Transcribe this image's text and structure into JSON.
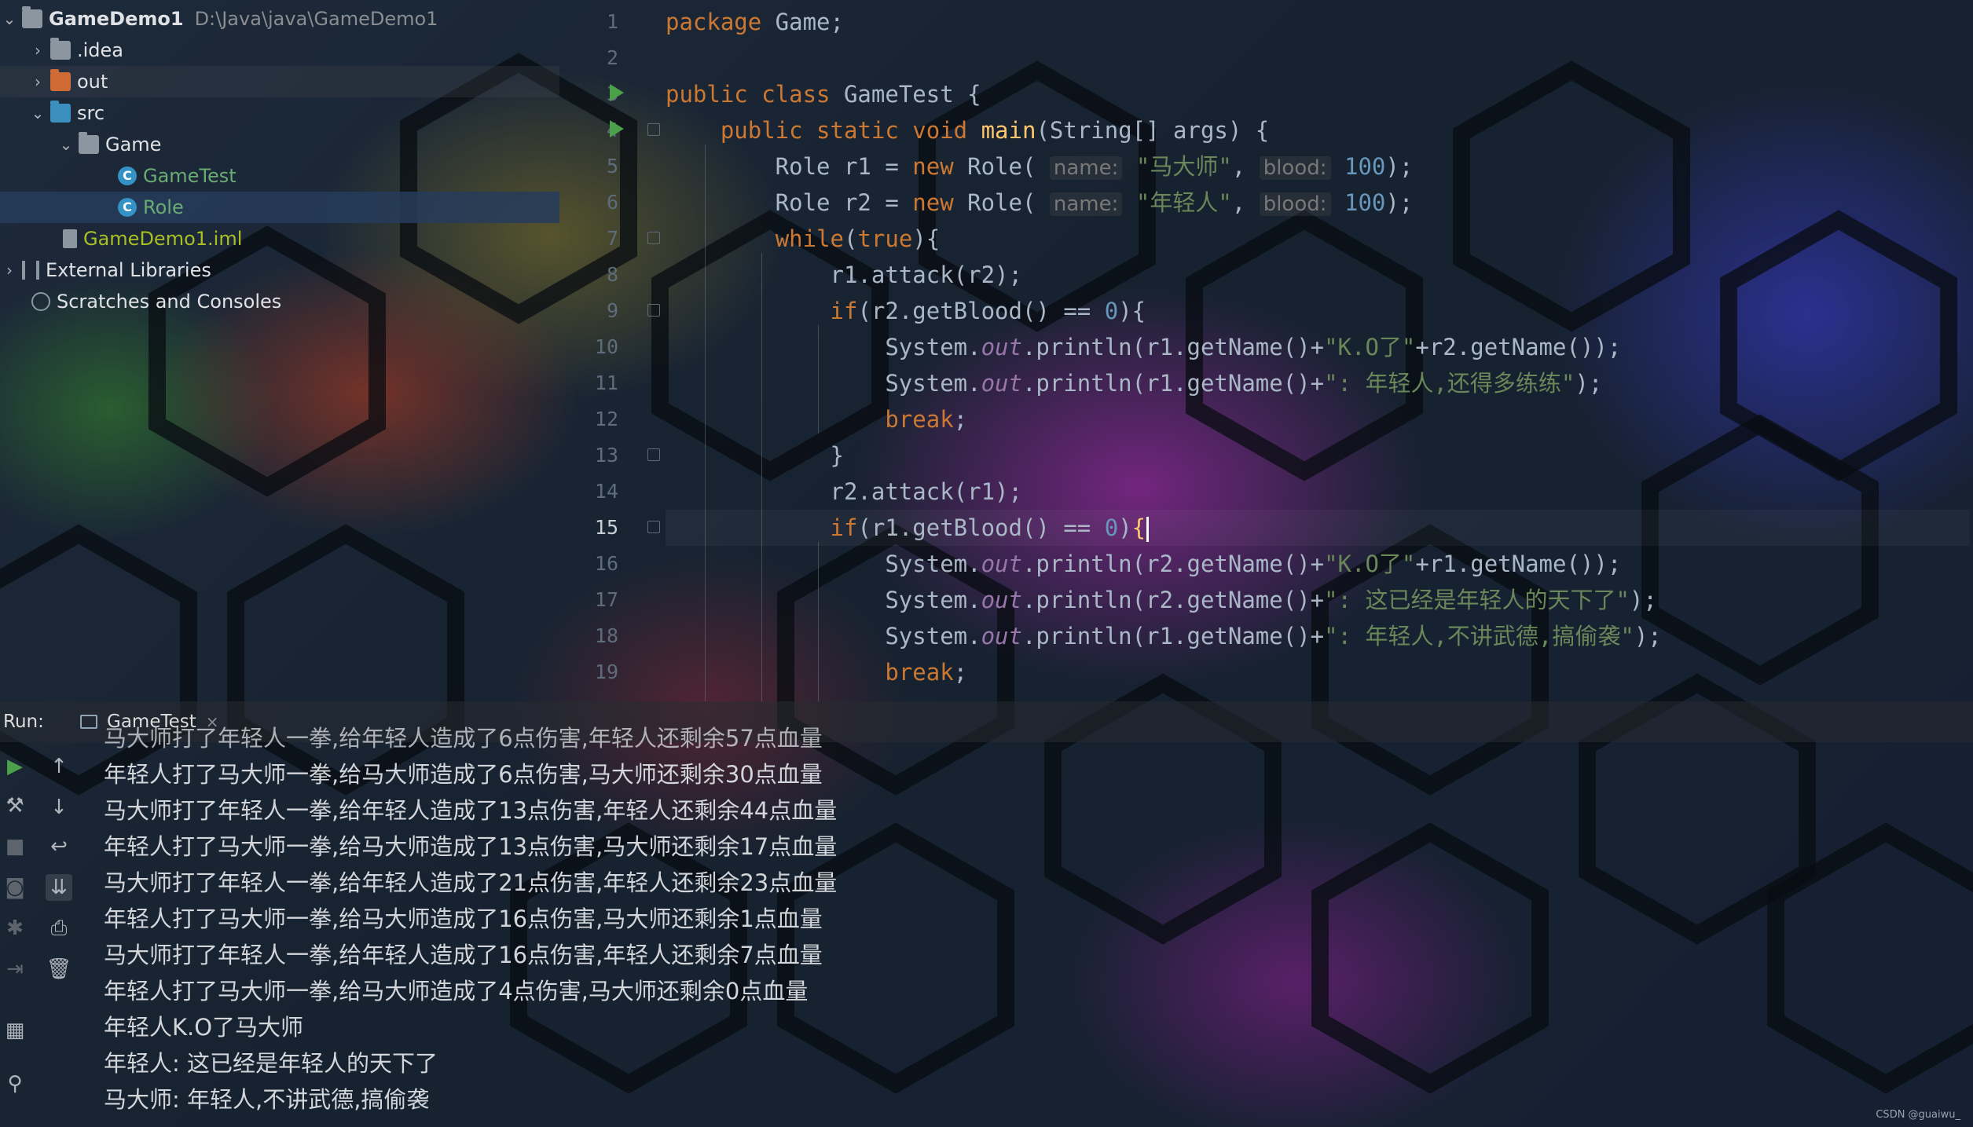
{
  "project": {
    "root_name": "GameDemo1",
    "root_path": "D:\\Java\\java\\GameDemo1",
    "items": [
      {
        "label": "GameDemo1",
        "icon": "folder-icon"
      },
      {
        "label": ".idea",
        "icon": "folder-icon"
      },
      {
        "label": "out",
        "icon": "folder-icon"
      },
      {
        "label": "src",
        "icon": "folder-icon"
      },
      {
        "label": "Game",
        "icon": "package-icon"
      },
      {
        "label": "GameTest",
        "icon": "java-class-icon"
      },
      {
        "label": "Role",
        "icon": "java-class-icon",
        "selected": true
      },
      {
        "label": "GameDemo1.iml",
        "icon": "module-file-icon"
      },
      {
        "label": "External Libraries",
        "icon": "library-icon"
      },
      {
        "label": "Scratches and Consoles",
        "icon": "scratches-icon"
      }
    ]
  },
  "editor": {
    "current_line": 15,
    "line_numbers": [
      "1",
      "2",
      "3",
      "4",
      "5",
      "6",
      "7",
      "8",
      "9",
      "10",
      "11",
      "12",
      "13",
      "14",
      "15",
      "16",
      "17",
      "18",
      "19"
    ]
  },
  "run": {
    "label": "Run:",
    "tab": "GameTest",
    "output": [
      "马大师打了年轻人一拳,给年轻人造成了6点伤害,年轻人还剩余57点血量",
      "年轻人打了马大师一拳,给马大师造成了6点伤害,马大师还剩余30点血量",
      "马大师打了年轻人一拳,给年轻人造成了13点伤害,年轻人还剩余44点血量",
      "年轻人打了马大师一拳,给马大师造成了13点伤害,马大师还剩余17点血量",
      "马大师打了年轻人一拳,给年轻人造成了21点伤害,年轻人还剩余23点血量",
      "年轻人打了马大师一拳,给马大师造成了16点伤害,马大师还剩余1点血量",
      "马大师打了年轻人一拳,给年轻人造成了16点伤害,年轻人还剩余7点血量",
      "年轻人打了马大师一拳,给马大师造成了4点伤害,马大师还剩余0点血量",
      "年轻人K.O了马大师",
      "年轻人: 这已经是年轻人的天下了",
      "马大师: 年轻人,不讲武德,搞偷袭"
    ]
  },
  "watermark": "CSDN @guaiwu_",
  "colors": {
    "keyword": "#cc7832",
    "string": "#6a8759",
    "number": "#6897bb",
    "method": "#ffc66d",
    "static_field": "#9876aa",
    "run_icon": "#4aa14a"
  }
}
